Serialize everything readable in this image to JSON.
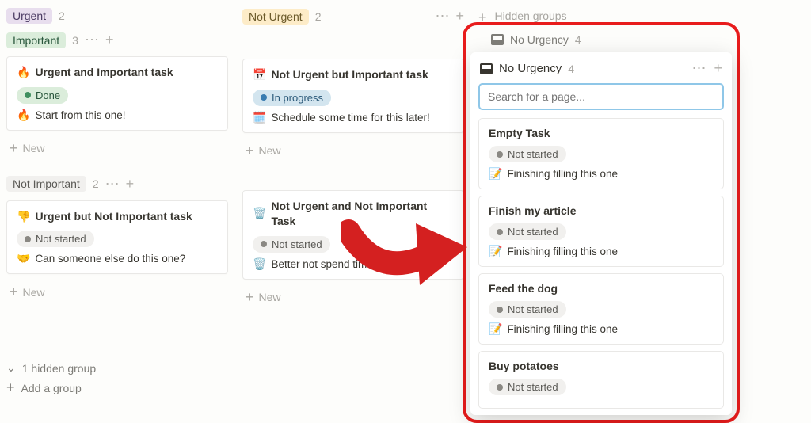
{
  "columns": {
    "urgent": {
      "label": "Urgent",
      "count": 2
    },
    "not_urgent": {
      "label": "Not Urgent",
      "count": 2
    },
    "hidden": {
      "label": "Hidden groups"
    }
  },
  "rows": {
    "important": {
      "label": "Important",
      "count": 3
    },
    "not_important": {
      "label": "Not Important",
      "count": 2
    }
  },
  "cards": {
    "c1": {
      "icon": "🔥",
      "title": "Urgent and Important task",
      "status": "Done",
      "desc_icon": "🔥",
      "desc": "Start from this one!"
    },
    "c2": {
      "icon": "📅",
      "title": "Not Urgent but Important task",
      "status": "In progress",
      "desc_icon": "🗓️",
      "desc": "Schedule some time for this later!"
    },
    "c3": {
      "icon": "👎",
      "title": "Urgent but Not Important task",
      "status": "Not started",
      "desc_icon": "🤝",
      "desc": "Can someone else do this one?"
    },
    "c4": {
      "icon": "🗑️",
      "title": "Not Urgent and Not Important Task",
      "status": "Not started",
      "desc_icon": "🗑️",
      "desc": "Better not spend time on"
    }
  },
  "new_label": "New",
  "bottom": {
    "hidden": "1 hidden group",
    "add": "Add a group"
  },
  "panel": {
    "ghost_label": "No Urgency",
    "ghost_count": 4,
    "title": "No Urgency",
    "count": 4,
    "search_placeholder": "Search for a page...",
    "items": [
      {
        "title": "Empty Task",
        "status": "Not started",
        "desc_icon": "📝",
        "desc": "Finishing filling this one"
      },
      {
        "title": "Finish my article",
        "status": "Not started",
        "desc_icon": "📝",
        "desc": "Finishing filling this one"
      },
      {
        "title": "Feed the dog",
        "status": "Not started",
        "desc_icon": "📝",
        "desc": "Finishing filling this one"
      },
      {
        "title": "Buy potatoes",
        "status": "Not started",
        "desc_icon": "",
        "desc": ""
      }
    ]
  }
}
